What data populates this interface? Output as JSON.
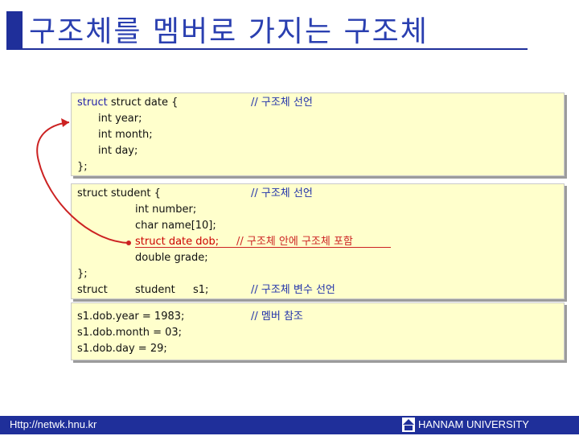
{
  "title": "구조체를 멤버로 가지는 구조체",
  "panel1": {
    "lines": [
      "struct date {",
      "int year;",
      "int month;",
      "int day;",
      "};"
    ],
    "comment": "// 구조체 선언"
  },
  "panel2": {
    "lines": [
      "struct student {",
      "int number;",
      "char name[10];",
      "struct date dob;",
      "double grade;",
      "};",
      "struct",
      "student",
      "s1;"
    ],
    "comments": [
      "// 구조체 선언",
      "// 구조체 안에 구조체 포함",
      "// 구조체 변수 선언"
    ]
  },
  "panel3": {
    "lines": [
      "s1.dob.year = 1983;",
      "s1.dob.month = 03;",
      "s1.dob.day = 29;"
    ],
    "comment": "// 멤버 참조"
  },
  "footer": {
    "url": "Http://netwk.hnu.kr",
    "university": "HANNAM UNIVERSITY"
  },
  "colors": {
    "title": "#2a3fb0",
    "bar": "#1f2f9a",
    "panel": "#ffffcc",
    "highlight": "#cc0000"
  }
}
